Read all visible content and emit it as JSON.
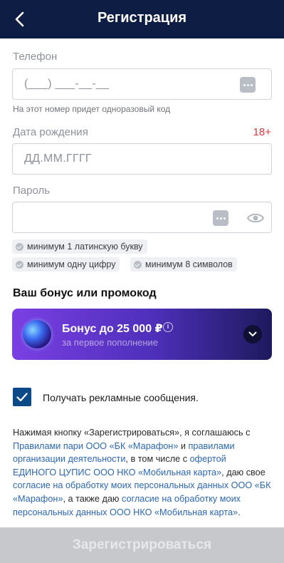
{
  "header": {
    "title": "Регистрация"
  },
  "phone": {
    "label": "Телефон",
    "placeholder": "(___) ___-__-__",
    "hint": "На этот номер придет одноразовый код"
  },
  "birth": {
    "label": "Дата рождения",
    "age_badge": "18+",
    "placeholder": "ДД.ММ.ГГГГ"
  },
  "password": {
    "label": "Пароль",
    "rules": [
      "минимум 1 латинскую букву",
      "минимум одну цифру",
      "минимум 8 символов"
    ]
  },
  "bonus": {
    "section_title": "Ваш бонус или промокод",
    "title": "Бонус до 25 000 ₽",
    "info": "i",
    "subtitle": "за первое пополнение"
  },
  "ads_checkbox": {
    "label": "Получать рекламные сообщения.",
    "checked": true
  },
  "legal": {
    "t1": "Нажимая кнопку «Зарегистрироваться», я соглашаюсь с ",
    "l1": "Правилами пари ООО «БК «Марафон»",
    "t2": " и ",
    "l2": "правилами организации деятельности",
    "t3": ", в том числе с ",
    "l3": "офертой ЕДИНОГО ЦУПИС ООО НКО «Мобильная карта»",
    "t4": ", даю свое ",
    "l4": "согласие на обработку моих персональных данных ООО «БК «Марафон»",
    "t5": ", а также даю ",
    "l5": "согласие на обработку моих персональных данных ООО НКО «Мобильная карта»",
    "t6": "."
  },
  "submit": {
    "label": "Зарегистрироваться"
  },
  "colors": {
    "header": "#0e1d44",
    "link": "#2b67b3",
    "accent_red": "#d63a3a",
    "checkbox": "#0b4a86"
  },
  "icons": [
    "back-arrow-icon",
    "keyboard-icon",
    "eye-icon",
    "check-icon",
    "info-icon",
    "chevron-down-icon"
  ]
}
